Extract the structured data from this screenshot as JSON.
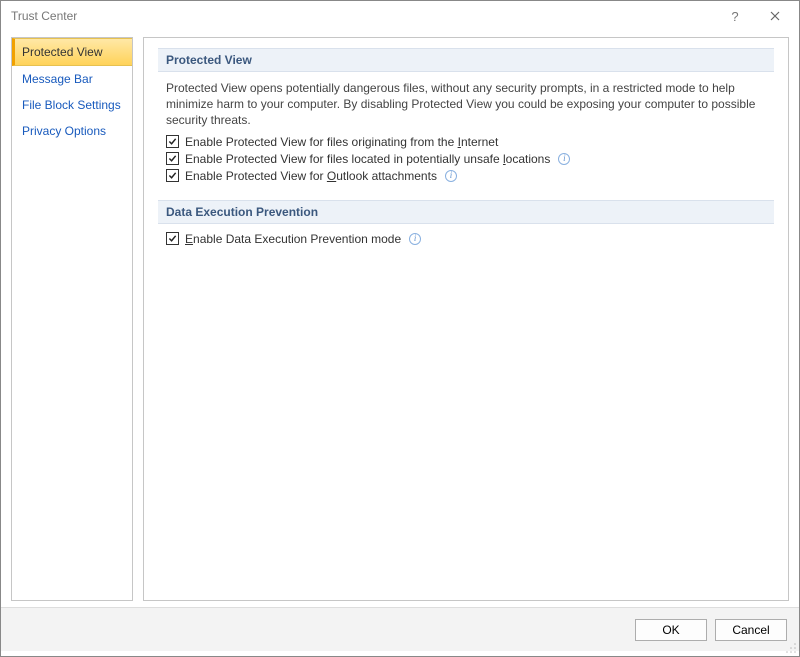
{
  "titlebar": {
    "title": "Trust Center",
    "help": "?",
    "close": "✕"
  },
  "sidebar": {
    "items": [
      {
        "label": "Protected View",
        "active": true
      },
      {
        "label": "Message Bar",
        "active": false
      },
      {
        "label": "File Block Settings",
        "active": false
      },
      {
        "label": "Privacy Options",
        "active": false
      }
    ]
  },
  "content": {
    "section1": {
      "header": "Protected View",
      "desc": "Protected View opens potentially dangerous files, without any security prompts, in a restricted mode to help minimize harm to your computer. By disabling Protected View you could be exposing your computer to possible security threats.",
      "check1_pre": "Enable Protected View for files originating from the ",
      "check1_accel": "I",
      "check1_post": "nternet",
      "check2_pre": "Enable Protected View for files located in potentially unsafe ",
      "check2_accel": "l",
      "check2_post": "ocations",
      "check3_pre": "Enable Protected View for ",
      "check3_accel": "O",
      "check3_post": "utlook attachments"
    },
    "section2": {
      "header": "Data Execution Prevention",
      "check1_accel": "E",
      "check1_post": "nable Data Execution Prevention mode"
    }
  },
  "footer": {
    "ok": "OK",
    "cancel": "Cancel"
  },
  "info_glyph": "i"
}
